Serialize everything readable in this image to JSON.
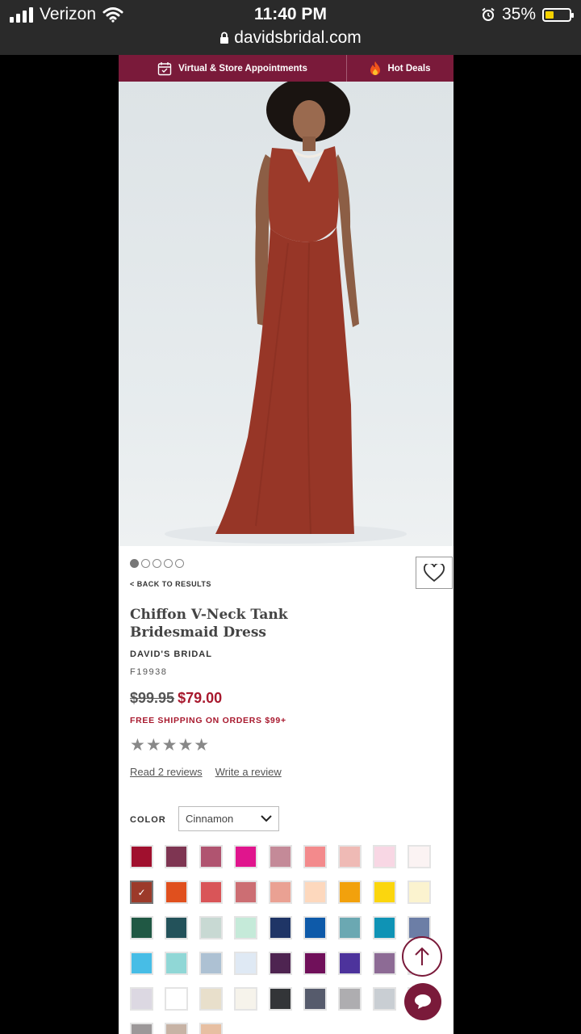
{
  "status_bar": {
    "carrier": "Verizon",
    "time": "11:40 PM",
    "battery": "35%",
    "url": "davidsbridal.com"
  },
  "promo": {
    "appointments_label": "Virtual & Store Appointments",
    "deals_label": "Hot Deals"
  },
  "gallery": {
    "image_count": 5,
    "active_index": 0
  },
  "product": {
    "back_label": "< BACK TO RESULTS",
    "title": "Chiffon V-Neck Tank Bridesmaid Dress",
    "brand": "DAVID'S BRIDAL",
    "sku": "F19938",
    "original_price": "$99.95",
    "sale_price": "$79.00",
    "shipping_note": "FREE SHIPPING ON ORDERS $99+",
    "stars": "★★★★★",
    "read_reviews": "Read 2 reviews",
    "write_review": "Write a review"
  },
  "color": {
    "label": "COLOR",
    "selected": "Cinnamon",
    "selected_index": 9,
    "swatches": [
      "#a0102e",
      "#7e3552",
      "#b05470",
      "#e0158d",
      "#c48a98",
      "#f38a8c",
      "#efbab5",
      "#f8d7e4",
      "#fbf3f3",
      "#9c3a2a",
      "#e0501e",
      "#d95558",
      "#cc6e73",
      "#eaa193",
      "#fdd8bd",
      "#f2a10c",
      "#fbd60e",
      "#fbf3cf",
      "#205844",
      "#23525a",
      "#c8d9d3",
      "#c5ead9",
      "#1f3566",
      "#0e5aa9",
      "#6ba8b2",
      "#0f93b5",
      "#6c7ea6",
      "#47bde6",
      "#90d7d6",
      "#adc1d3",
      "#dfe9f4",
      "#4e2451",
      "#70105a",
      "#4d339c",
      "#8d6b95",
      "#d8d0d8",
      "#dcd8e2",
      "#ffffff",
      "#e8dfcb",
      "#f6f3eb",
      "#333538",
      "#565b6c",
      "#aeadb0",
      "#c9ced3",
      "#e0dfe4",
      "#9c9899",
      "#c7b3a5",
      "#e7bfa2"
    ]
  },
  "colors": {
    "brand": "#7a1a3a",
    "sale_red": "#a8192e",
    "dress": "#9c3a2a"
  },
  "icons": [
    "signal-icon",
    "wifi-icon",
    "alarm-icon",
    "battery-icon",
    "lock-icon",
    "calendar-icon",
    "fire-icon",
    "heart-icon",
    "chevron-down-icon",
    "check-icon",
    "arrow-up-icon",
    "chat-icon"
  ]
}
